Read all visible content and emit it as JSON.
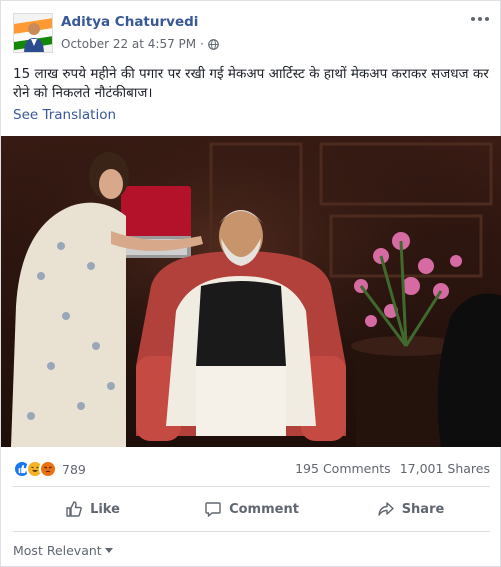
{
  "post": {
    "author": "Aditya Chaturvedi",
    "timestamp": "October 22 at 4:57 PM",
    "separator": "·",
    "audience_icon": "globe-icon",
    "text": "15 लाख रुपये महीने की पगार पर रखी गई मेकअप आर्टिस्ट के हाथों मेकअप कराकर सजधज कर रोने को निकलते नौटंकीबाज।",
    "see_translation": "See Translation"
  },
  "reactions": {
    "icons": [
      "like-reaction-icon",
      "haha-reaction-icon",
      "angry-reaction-icon"
    ],
    "colors": {
      "like": "#1877f2",
      "haha": "#f7b125",
      "angry": "#e9710f"
    },
    "count": "789"
  },
  "counts": {
    "comments": "195 Comments",
    "shares": "17,001 Shares"
  },
  "actions": {
    "like": "Like",
    "comment": "Comment",
    "share": "Share"
  },
  "comments_filter": {
    "label": "Most Relevant"
  },
  "colors": {
    "link": "#385898",
    "secondary_text": "#616770"
  }
}
